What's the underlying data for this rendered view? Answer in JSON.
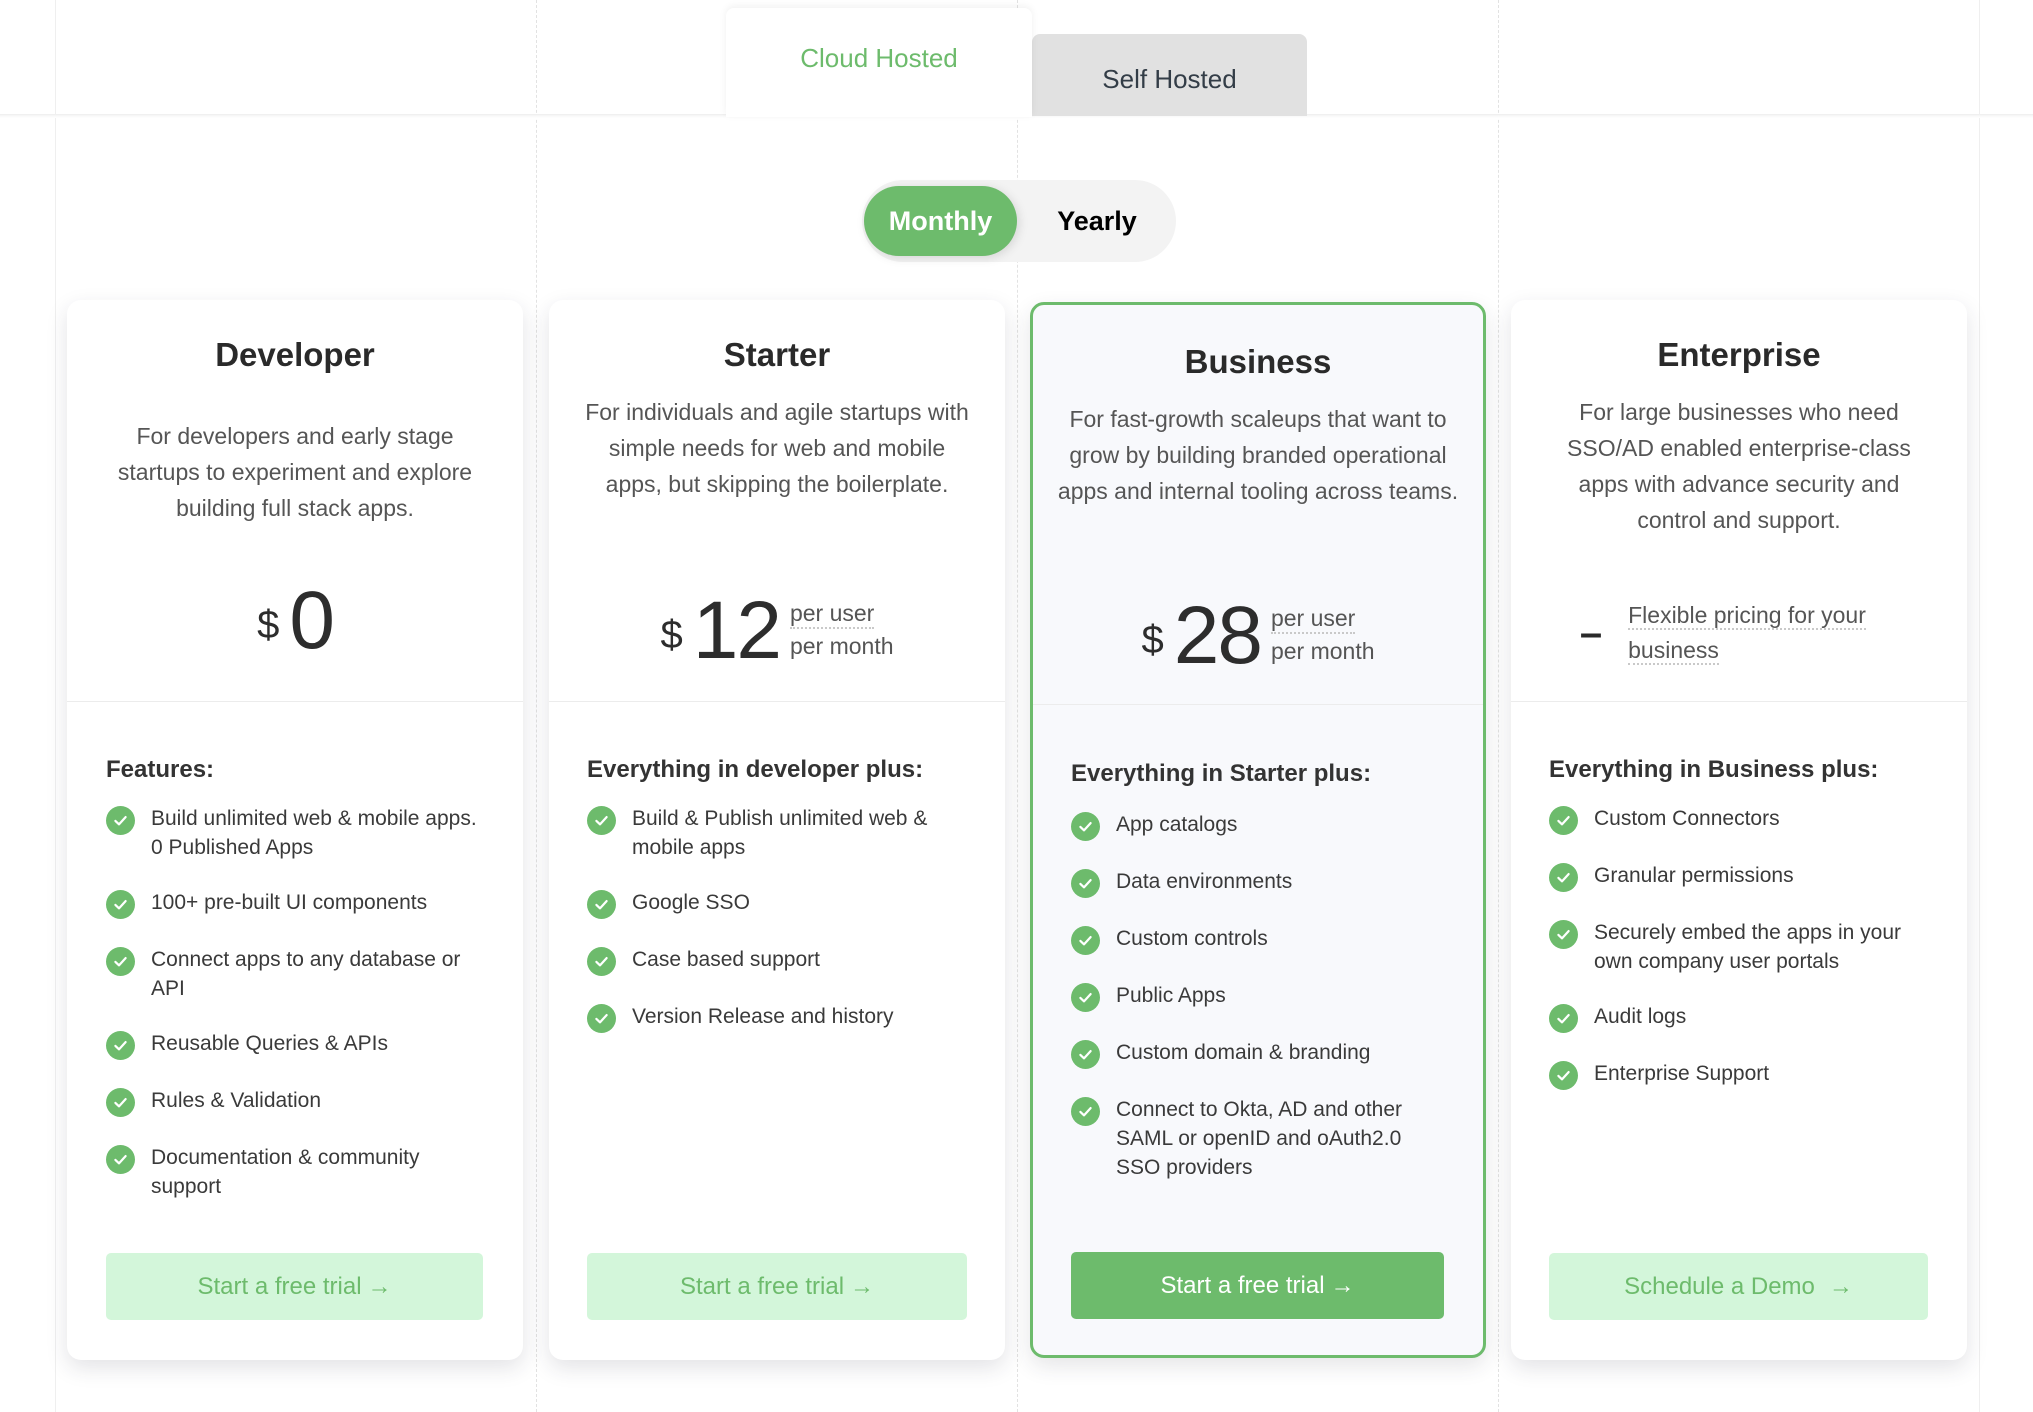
{
  "hosting_tabs": [
    {
      "label": "Cloud Hosted",
      "active": true
    },
    {
      "label": "Self Hosted",
      "active": false
    }
  ],
  "billing_toggle": {
    "options": [
      {
        "label": "Monthly",
        "active": true
      },
      {
        "label": "Yearly",
        "active": false
      }
    ]
  },
  "colors": {
    "accent": "#6dbb6c",
    "accent_light": "#d3f6da",
    "featured_bg": "#f8f9fc"
  },
  "plans": [
    {
      "name": "Developer",
      "description": "For developers and early stage startups to experiment and explore building full stack apps.",
      "currency": "$",
      "amount": "0",
      "features_title": "Features:",
      "features": [
        "Build unlimited web & mobile apps. 0 Published Apps",
        "100+ pre-built UI components",
        "Connect apps to any database or API",
        "Reusable Queries & APIs",
        "Rules & Validation",
        "Documentation & community support"
      ],
      "cta": {
        "label": "Start a free trial",
        "icon": "arrow-right-icon"
      }
    },
    {
      "name": "Starter",
      "description": "For individuals and agile startups with simple needs for web and mobile apps, but skipping the boilerplate.",
      "currency": "$",
      "amount": "12",
      "unit_line1": "per user",
      "unit_line2": "per month",
      "features_title": "Everything in developer plus:",
      "features": [
        "Build & Publish unlimited web & mobile apps",
        "Google SSO",
        "Case based support",
        "Version Release and history"
      ],
      "cta": {
        "label": "Start a free trial",
        "icon": "arrow-right-icon"
      }
    },
    {
      "name": "Business",
      "featured": true,
      "description": "For fast-growth scaleups that want to grow by building branded operational apps and internal tooling across teams.",
      "currency": "$",
      "amount": "28",
      "unit_line1": "per user",
      "unit_line2": "per month",
      "features_title": "Everything in Starter plus:",
      "features": [
        "App catalogs",
        "Data environments",
        "Custom controls",
        "Public Apps",
        "Custom domain & branding",
        "Connect to Okta, AD and other SAML or openID and oAuth2.0 SSO providers"
      ],
      "cta": {
        "label": "Start a free trial",
        "icon": "arrow-right-icon"
      }
    },
    {
      "name": "Enterprise",
      "description": "For large businesses who need SSO/AD enabled enterprise-class apps with advance security and control and support.",
      "price_dash": "–",
      "price_text": "Flexible pricing for your business",
      "features_title": "Everything in Business plus:",
      "features": [
        "Custom Connectors",
        "Granular permissions",
        "Securely embed the apps in your own company user portals",
        "Audit logs",
        "Enterprise Support"
      ],
      "cta": {
        "label": "Schedule a Demo",
        "icon": "arrow-right-icon"
      }
    }
  ],
  "icons": {
    "check": "check-circle-icon",
    "arrow": "→"
  }
}
